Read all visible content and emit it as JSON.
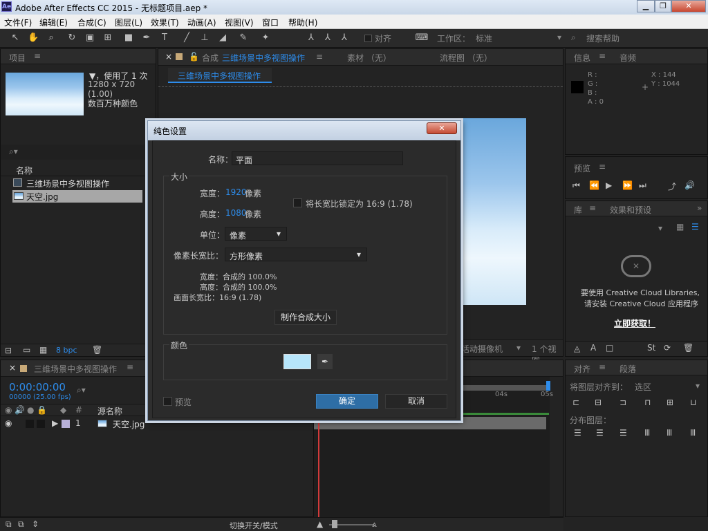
{
  "window": {
    "title": "Adobe After Effects CC 2015 - 无标题项目.aep *",
    "logo": "Ae"
  },
  "menu": [
    "文件(F)",
    "编辑(E)",
    "合成(C)",
    "图层(L)",
    "效果(T)",
    "动画(A)",
    "视图(V)",
    "窗口",
    "帮助(H)"
  ],
  "toolbar": {
    "align_label": "对齐",
    "workspace_label": "工作区：",
    "workspace_value": "标准",
    "search_placeholder": "搜索帮助"
  },
  "project": {
    "tab": "项目",
    "used_text": "▼，使用了 1 次",
    "resolution": "1280 x 720 (1.00)",
    "colors": "数百万种颜色",
    "search_icon": "⌕▾",
    "name_header": "名称",
    "items": [
      {
        "name": "三维场景中多视图操作",
        "selected": false
      },
      {
        "name": "天空.jpg",
        "selected": true
      }
    ],
    "bpc": "8 bpc"
  },
  "comp": {
    "tabs": [
      "合成",
      "三维场景中多视图操作",
      "素材 （无）",
      "流程图 （无）"
    ],
    "breadcrumb": "三维场景中多视图操作",
    "camera_text": "活动摄像机",
    "views_text": "1 个视图"
  },
  "info": {
    "tab1": "信息",
    "tab2": "音频",
    "r": "R :",
    "g": "G :",
    "b": "B :",
    "a": "A : 0",
    "x": "X : 144",
    "y": "Y : 1044"
  },
  "preview": {
    "tab": "预览"
  },
  "library": {
    "tab1": "库",
    "tab2": "效果和预设",
    "message1": "要使用 Creative Cloud Libraries,",
    "message2": "请安装 Creative Cloud 应用程序",
    "link": "立即获取！"
  },
  "align": {
    "tab1": "对齐",
    "tab2": "段落",
    "align_to_label": "将图层对齐到：",
    "align_to_value": "选区",
    "distribute_label": "分布图层："
  },
  "timeline": {
    "tab": "三维场景中多视图操作",
    "timecode": "0:00:00:00",
    "frame_info": "00000 (25.00 fps)",
    "hash": "#",
    "source_header": "源名称",
    "layer_index": "1",
    "layer_name": "天空.jpg",
    "ruler": [
      "04s",
      "05s"
    ],
    "switch_label": "切换开关/模式"
  },
  "dialog": {
    "title": "纯色设置",
    "name_label": "名称：",
    "name_value": "平面",
    "size_label": "大小",
    "width_label": "宽度：",
    "width_value": "1920",
    "height_label": "高度：",
    "height_value": "1080",
    "unit_px": "像素",
    "lock_text": "将长宽比锁定为 16:9 (1.78)",
    "units_label": "单位：",
    "units_value": "像素",
    "par_label": "像素长宽比：",
    "par_value": "方形像素",
    "info_w": "宽度：合成的 100.0%",
    "info_h": "高度：合成的 100.0%",
    "info_ar": "画面长宽比：16:9 (1.78)",
    "make_comp_size": "制作合成大小",
    "color_label": "颜色",
    "color_swatch": "#b7e6fb",
    "preview_label": "预览",
    "ok": "确定",
    "cancel": "取消"
  },
  "colors": {
    "accent": "#2d8ceb",
    "playhead": "#d23a3a",
    "swatch": "#b7e6fb",
    "ok_button": "#2e6ea6"
  }
}
